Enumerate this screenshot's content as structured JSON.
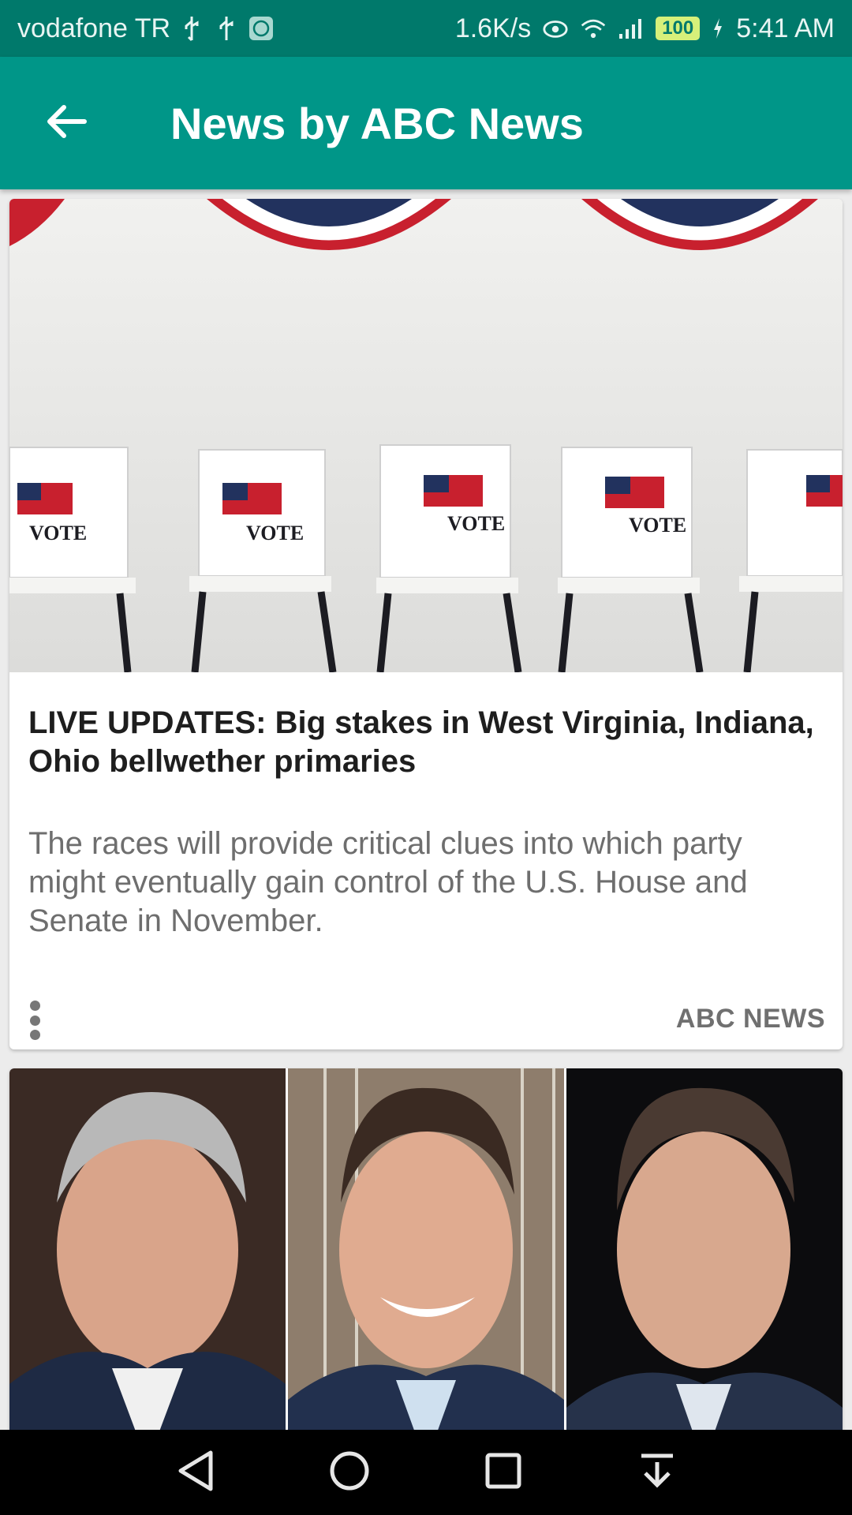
{
  "status_bar": {
    "carrier": "vodafone TR",
    "net_speed": "1.6K/s",
    "battery": "100",
    "time": "5:41 AM",
    "icons": [
      "usb-icon",
      "usb-icon",
      "mi-app-icon",
      "eye-icon",
      "wifi-icon",
      "signal-icon",
      "battery-icon",
      "charging-icon"
    ]
  },
  "app_bar": {
    "title": "News by ABC News",
    "back_icon": "arrow-left-icon"
  },
  "articles": [
    {
      "image": "voting-booths-photo",
      "headline": "LIVE UPDATES: Big stakes in West Virginia, Indiana, Ohio bellwether primaries",
      "summary": "The races will provide critical clues into which party might eventually gain control of the U.S. House and Senate in November.",
      "source": "ABC NEWS",
      "menu_icon": "more-vertical-icon"
    },
    {
      "image": "three-candidates-photo"
    }
  ],
  "colors": {
    "status_bar": "#00796b",
    "app_bar": "#009688",
    "nav_bar": "#000000"
  },
  "nav_bar": {
    "icons": [
      "back-triangle-icon",
      "home-circle-icon",
      "recents-square-icon",
      "notification-pull-icon"
    ]
  }
}
